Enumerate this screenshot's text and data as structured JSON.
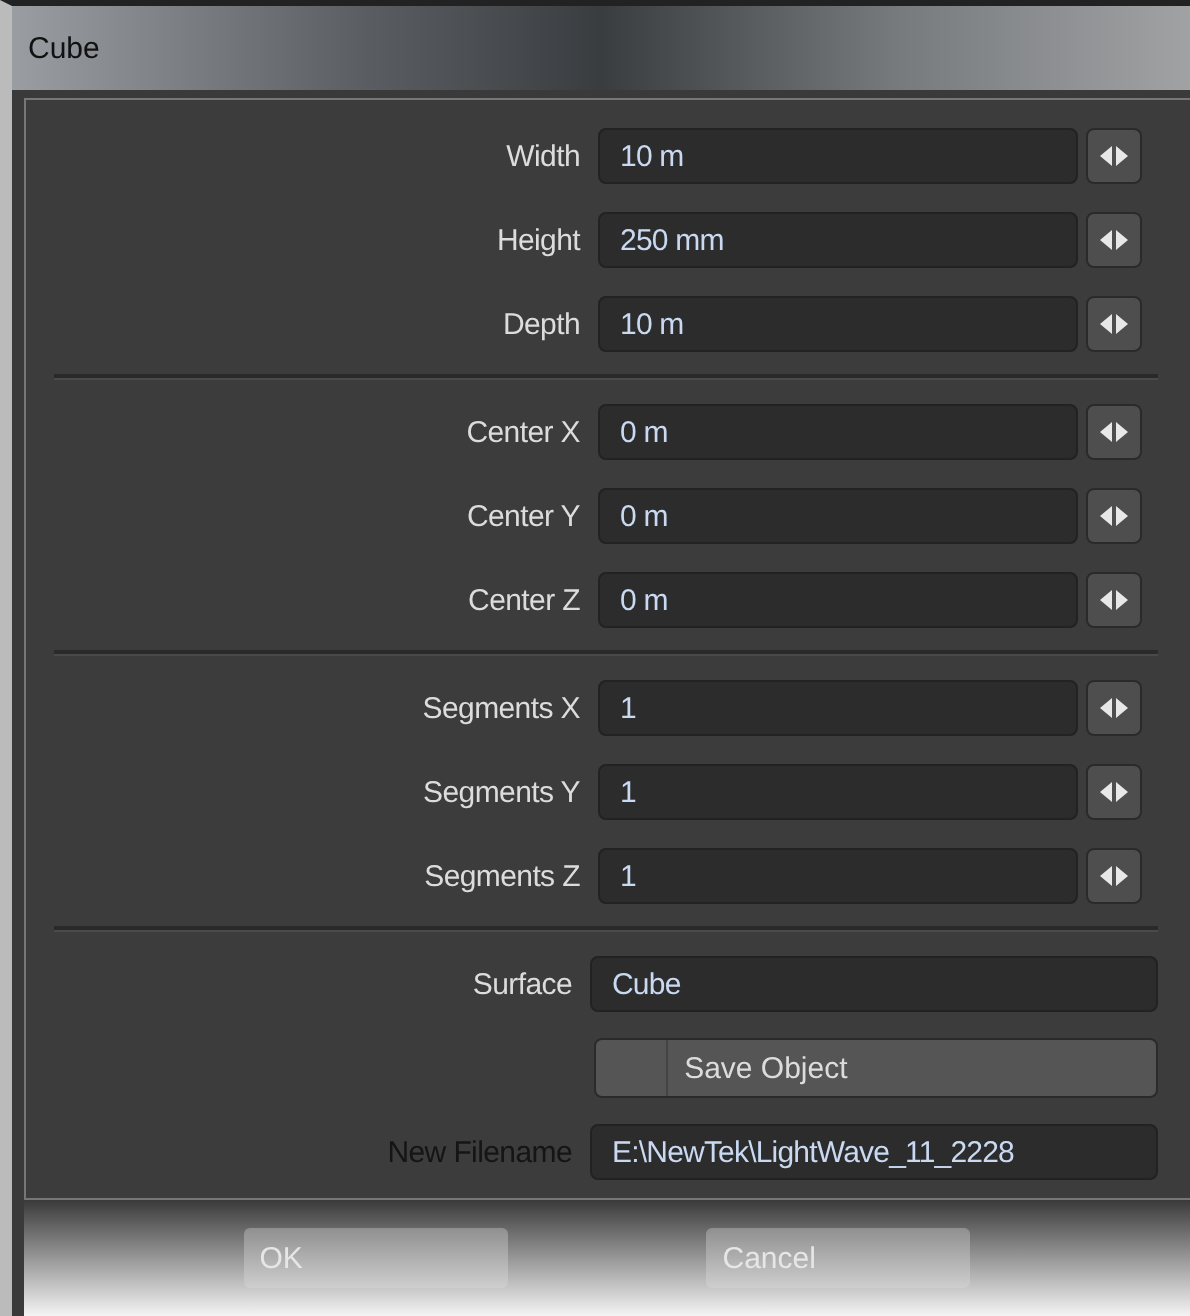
{
  "window": {
    "title": "Cube"
  },
  "groups": [
    {
      "rows": [
        {
          "kind": "spinner",
          "label": "Width",
          "value": "10 m",
          "disabled": false
        },
        {
          "kind": "spinner",
          "label": "Height",
          "value": "250 mm",
          "disabled": false
        },
        {
          "kind": "spinner",
          "label": "Depth",
          "value": "10 m",
          "disabled": false
        }
      ]
    },
    {
      "rows": [
        {
          "kind": "spinner",
          "label": "Center X",
          "value": "0 m",
          "disabled": false
        },
        {
          "kind": "spinner",
          "label": "Center Y",
          "value": "0 m",
          "disabled": false
        },
        {
          "kind": "spinner",
          "label": "Center Z",
          "value": "0 m",
          "disabled": false
        }
      ]
    },
    {
      "rows": [
        {
          "kind": "spinner",
          "label": "Segments X",
          "value": "1",
          "disabled": false
        },
        {
          "kind": "spinner",
          "label": "Segments Y",
          "value": "1",
          "disabled": false
        },
        {
          "kind": "spinner",
          "label": "Segments Z",
          "value": "1",
          "disabled": false
        }
      ]
    },
    {
      "rows": [
        {
          "kind": "text",
          "label": "Surface",
          "value": "Cube",
          "disabled": false
        },
        {
          "kind": "button",
          "value": "Save Object",
          "disabled": false
        },
        {
          "kind": "text",
          "label": "New Filename",
          "value": "E:\\NewTek\\LightWave_11_2228",
          "disabled": true
        }
      ]
    }
  ],
  "buttons": [
    "OK",
    "Cancel"
  ]
}
